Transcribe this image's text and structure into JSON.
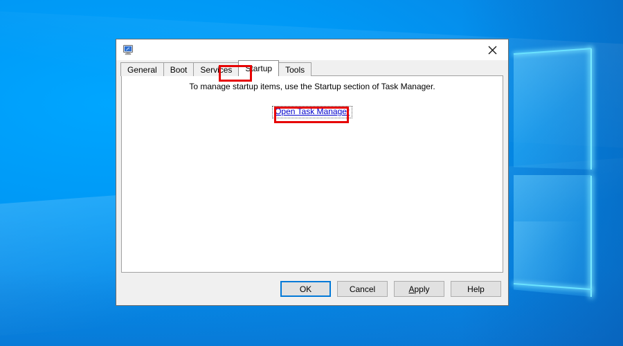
{
  "desktop": {
    "wallpaper_name": "windows-default-blue-wallpaper",
    "background_color": "#0099f7",
    "accent_glow_color": "#6ee7ff"
  },
  "dialog": {
    "title": "",
    "icon_name": "system-configuration-icon",
    "close_label": "✕",
    "tabs": [
      {
        "label": "General",
        "selected": false
      },
      {
        "label": "Boot",
        "selected": false
      },
      {
        "label": "Services",
        "selected": false
      },
      {
        "label": "Startup",
        "selected": true
      },
      {
        "label": "Tools",
        "selected": false
      }
    ],
    "startup_page": {
      "message": "To manage startup items, use the Startup section of Task Manager.",
      "link_label": "Open Task Manager",
      "link_color": "#0000cc"
    },
    "buttons": [
      {
        "label": "OK",
        "default": true,
        "accel": ""
      },
      {
        "label": "Cancel",
        "default": false,
        "accel": ""
      },
      {
        "label": "Apply",
        "default": false,
        "accel": "A"
      },
      {
        "label": "Help",
        "default": false,
        "accel": ""
      }
    ]
  },
  "annotations": {
    "color": "#e60000",
    "boxes": [
      {
        "target": "Startup",
        "name": "startup-tab-highlight"
      },
      {
        "target": "Open Task Manager",
        "name": "open-task-manager-highlight"
      }
    ]
  }
}
